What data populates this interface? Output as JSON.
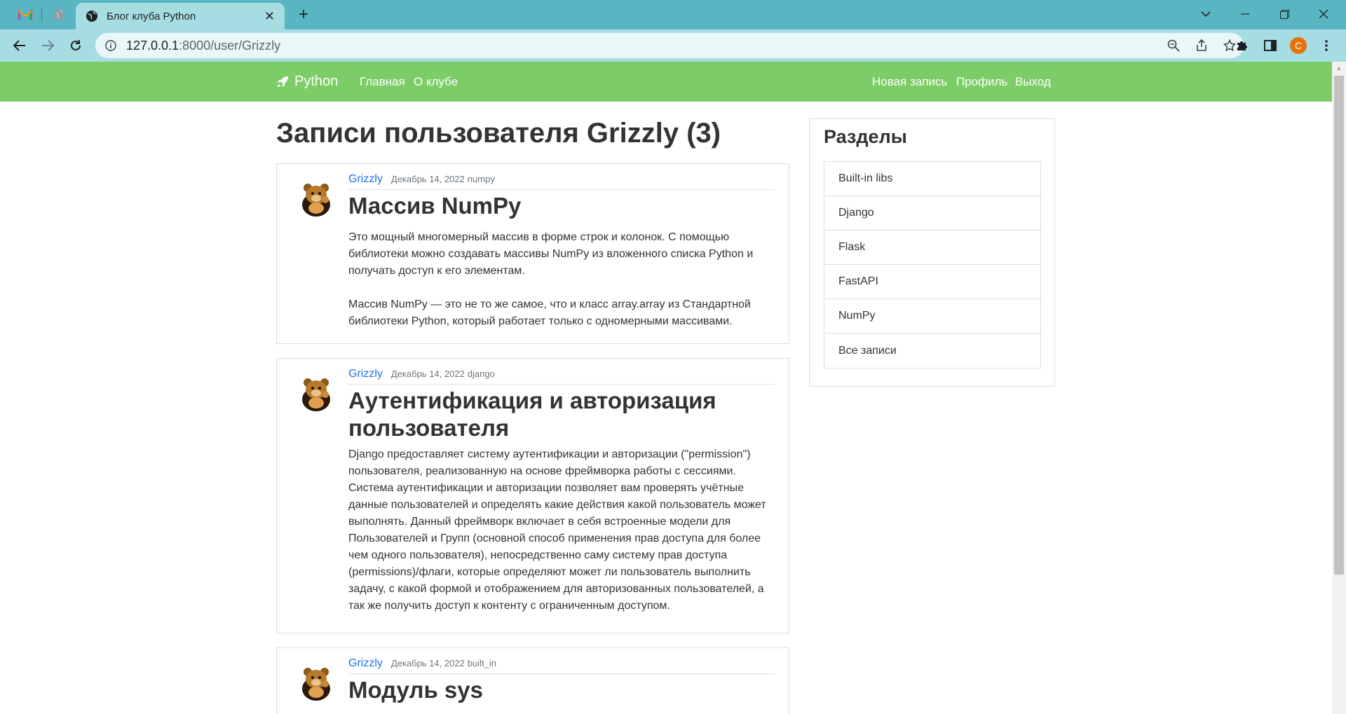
{
  "browser": {
    "pinned_tabs": [
      {
        "name": "gmail-icon"
      },
      {
        "name": "globe-icon"
      }
    ],
    "active_tab": {
      "title": "Блог клуба Python"
    },
    "url": {
      "host": "127.0.0.1",
      "path": ":8000/user/Grizzly"
    },
    "profile_initial": "C",
    "colors": {
      "tabbar": "#5ab5c2",
      "toolbar": "#a6dde3",
      "profile": "#e8710a"
    }
  },
  "site": {
    "brand": "Python",
    "nav_left": [
      "Главная",
      "О клубе"
    ],
    "nav_right": [
      "Новая запись",
      "Профиль",
      "Выход"
    ],
    "navbar_color": "#7ccd67"
  },
  "page": {
    "title": "Записи пользователя Grizzly (3)"
  },
  "posts": [
    {
      "author": "Grizzly",
      "date": "Декабрь 14, 2022",
      "category": "numpy",
      "title": "Массив NumPy",
      "paragraphs": [
        "Это мощный многомерный массив в форме строк и колонок. С помощью библиотеки можно создавать массивы NumPy из вложенного списка Python и получать доступ к его элементам.",
        "Массив NumPy — это не то же самое, что и класс array.array из Стандартной библиотеки Python, который работает только с одномерными массивами."
      ]
    },
    {
      "author": "Grizzly",
      "date": "Декабрь 14, 2022",
      "category": "django",
      "title": "Аутентификация и авторизация пользователя",
      "paragraphs": [
        "Django предоставляет систему аутентификации и авторизации (\"permission\") пользователя, реализованную на основе фреймворка работы с сессиями. Система аутентификации и авторизации позволяет вам проверять учётные данные пользователей и определять какие действия какой пользователь может выполнять. Данный фреймворк включает в себя встроенные модели для Пользователей и Групп (основной способ применения прав доступа для более чем одного пользователя), непосредственно саму систему прав доступа (permissions)/флаги, которые определяют может ли пользователь выполнить задачу, с какой формой и отображением для авторизованных пользователей, а так же получить доступ к контенту с ограниченным доступом."
      ]
    },
    {
      "author": "Grizzly",
      "date": "Декабрь 14, 2022",
      "category": "built_in",
      "title": "Модуль sys",
      "paragraphs": [
        ""
      ]
    }
  ],
  "sidebar": {
    "title": "Разделы",
    "items": [
      "Built-in libs",
      "Django",
      "Flask",
      "FastAPI",
      "NumPy",
      "Все записи"
    ]
  }
}
